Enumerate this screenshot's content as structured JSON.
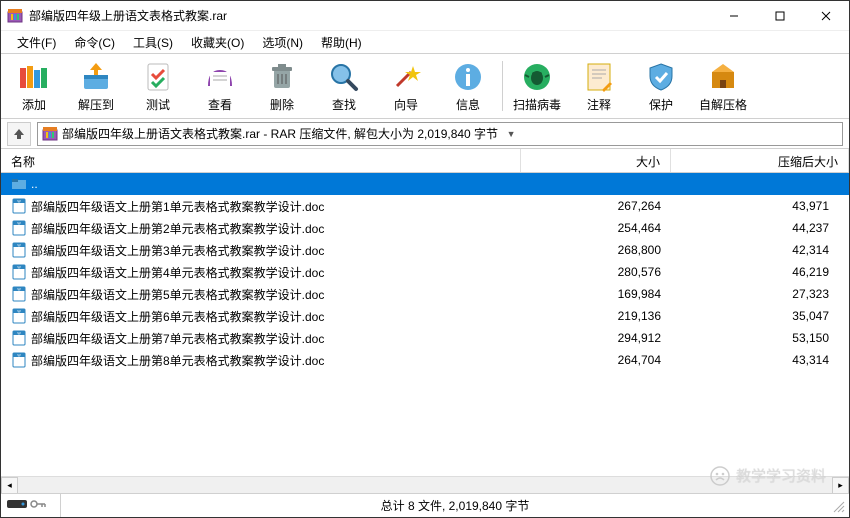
{
  "window": {
    "title": "部编版四年级上册语文表格式教案.rar"
  },
  "menu": {
    "file": "文件(F)",
    "commands": "命令(C)",
    "tools": "工具(S)",
    "favorites": "收藏夹(O)",
    "options": "选项(N)",
    "help": "帮助(H)"
  },
  "toolbar": {
    "add": "添加",
    "extract": "解压到",
    "test": "测试",
    "view": "查看",
    "delete": "删除",
    "find": "查找",
    "wizard": "向导",
    "info": "信息",
    "virus": "扫描病毒",
    "comment": "注释",
    "protect": "保护",
    "sfx": "自解压格"
  },
  "path": {
    "text": "部编版四年级上册语文表格式教案.rar - RAR 压缩文件, 解包大小为 2,019,840 字节"
  },
  "columns": {
    "name": "名称",
    "size": "大小",
    "compressed": "压缩后大小"
  },
  "parent_row": "..",
  "files": [
    {
      "name": "部编版四年级语文上册第1单元表格式教案教学设计.doc",
      "size": "267,264",
      "csize": "43,971"
    },
    {
      "name": "部编版四年级语文上册第2单元表格式教案教学设计.doc",
      "size": "254,464",
      "csize": "44,237"
    },
    {
      "name": "部编版四年级语文上册第3单元表格式教案教学设计.doc",
      "size": "268,800",
      "csize": "42,314"
    },
    {
      "name": "部编版四年级语文上册第4单元表格式教案教学设计.doc",
      "size": "280,576",
      "csize": "46,219"
    },
    {
      "name": "部编版四年级语文上册第5单元表格式教案教学设计.doc",
      "size": "169,984",
      "csize": "27,323"
    },
    {
      "name": "部编版四年级语文上册第6单元表格式教案教学设计.doc",
      "size": "219,136",
      "csize": "35,047"
    },
    {
      "name": "部编版四年级语文上册第7单元表格式教案教学设计.doc",
      "size": "294,912",
      "csize": "53,150"
    },
    {
      "name": "部编版四年级语文上册第8单元表格式教案教学设计.doc",
      "size": "264,704",
      "csize": "43,314"
    }
  ],
  "status": {
    "summary": "总计 8 文件, 2,019,840 字节"
  },
  "watermark": "教学学习资料"
}
